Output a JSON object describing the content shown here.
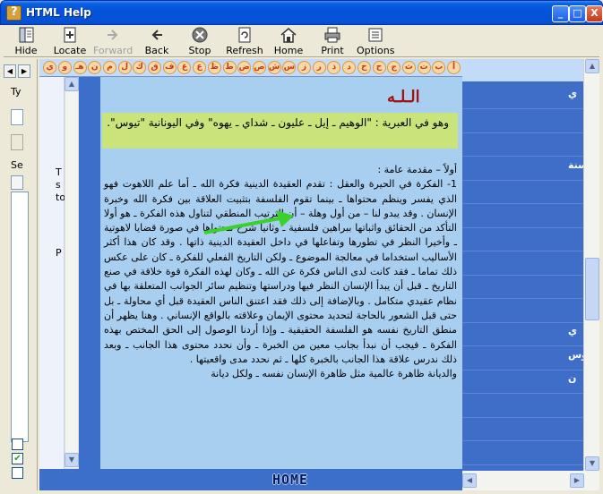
{
  "window": {
    "title": "HTML Help",
    "controls": {
      "minimize": "_",
      "maximize": "□",
      "close": "X"
    }
  },
  "toolbar": {
    "buttons": [
      {
        "label": "Hide",
        "icon": "hide-icon",
        "enabled": true
      },
      {
        "label": "Locate",
        "icon": "locate-icon",
        "enabled": true
      },
      {
        "label": "Forward",
        "icon": "forward-arrow-icon",
        "enabled": false
      },
      {
        "label": "Back",
        "icon": "back-arrow-icon",
        "enabled": true
      },
      {
        "label": "Stop",
        "icon": "stop-icon",
        "enabled": true
      },
      {
        "label": "Refresh",
        "icon": "refresh-icon",
        "enabled": true
      },
      {
        "label": "Home",
        "icon": "home-icon",
        "enabled": true
      },
      {
        "label": "Print",
        "icon": "printer-icon",
        "enabled": true
      },
      {
        "label": "Options",
        "icon": "options-icon",
        "enabled": true
      }
    ]
  },
  "navpane": {
    "label_type": "Ty",
    "label_select": "Se",
    "checkboxes": [
      {
        "checked": false
      },
      {
        "checked": true
      },
      {
        "checked": false
      }
    ]
  },
  "inner_left": {
    "letters": [
      "T",
      "s",
      "to",
      "P"
    ]
  },
  "alphabet": {
    "letters": [
      "أ",
      "ب",
      "ت",
      "ث",
      "ج",
      "ح",
      "خ",
      "د",
      "ذ",
      "ر",
      "ز",
      "س",
      "ش",
      "ص",
      "ض",
      "ط",
      "ظ",
      "ع",
      "غ",
      "ف",
      "ق",
      "ك",
      "ل",
      "م",
      "ن",
      "هـ",
      "و",
      "ي"
    ]
  },
  "right_list": {
    "rows": [
      "ي",
      "",
      "",
      "سنة",
      "",
      "",
      "",
      "",
      "",
      "",
      "ي",
      "وس",
      "ن",
      "",
      "",
      "",
      ""
    ]
  },
  "page": {
    "title": "الـلـه",
    "highlight": "وهو في العبرية : \"الوهيم ـ إيل ـ عليون ـ شداي ـ يهوه\" وفي اليونانية \"تيوس\".",
    "section_heading": "أولاً – مقدمة عامة :",
    "body": "1- الفكرة في الحيرة والعقل : تقدم العقيدة الدينية فكرة الله ـ أما علم اللاهوت فهو الذي يفسر وينظم محتواها ـ بينما تقوم الفلسفة بتثبيت العلاقة بين فكرة الله وخبرة الإنسان . وقد يبدو لنا – من أول وهلة – أن الترتيب المنطقي لتناول هذه الفكرة ـ هو أولا التأكد من الحقائق واثباتها ببراهين فلسفية ـ وثانيا شرح محتواها في صورة قضايا لاهوتية ـ وأخيرا النظر في تطورها وتفاعلها في داخل العقيدة الدينية ذاتها . وقد كان هذا أكثر الأساليب استخداما في معالجة الموضوع ـ ولكن التاريخ الفعلي للفكرة ـ كان على عكس ذلك تماما ـ فقد كانت لدى الناس فكرة عن الله ـ وكان لهذه الفكرة قوة خلاقة في صنع التاريخ ـ قبل أن يبدأ الإنسان النظر فيها ودراستها وتنظيم سائر الجوانب المتعلقة بها في نظام عقيدي متكامل . وبالإضافة إلى ذلك فقد اعتنق الناس العقيدة قبل أي محاولة ـ بل حتى قبل الشعور بالحاجة لتحديد محتوى الإيمان وعلاقته بالواقع الإنساني . وهنا يظهر أن منطق التاريخ نفسه هو الفلسفة الحقيقية ـ وإذا أردنا الوصول إلى الحق المختص بهذه الفكرة ـ فيجب أن نبدأ بجانب معين من الخبرة ـ وأن نحدد محتوى هذا الجانب ـ وبعد ذلك ندرس علاقة هذا الجانب بالخبرة كلها ـ ثم نحدد مدى واقعيتها .",
    "last_line": "والديانة ظاهرة عالمية مثل ظاهرة الإنسان نفسه ـ ولكل ديانة"
  },
  "footer": {
    "home_label": "HOME"
  },
  "colors": {
    "page_bg": "#a8cef0",
    "highlight_bg": "#c8e47a",
    "title_red": "#a51010",
    "frame_blue": "#3c6fc9",
    "annotation_arrow": "#3bd12b"
  }
}
